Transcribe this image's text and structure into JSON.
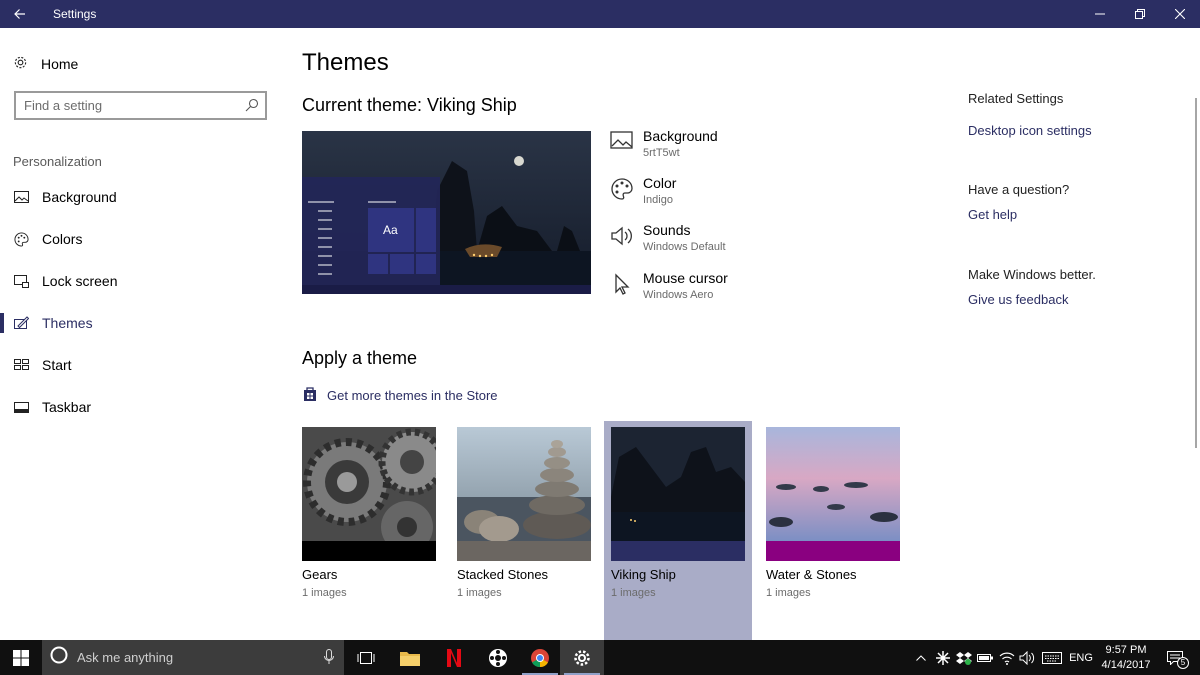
{
  "window": {
    "title": "Settings"
  },
  "sidebar": {
    "home_label": "Home",
    "search_placeholder": "Find a setting",
    "section_label": "Personalization",
    "items": [
      {
        "label": "Background",
        "icon": "picture-icon"
      },
      {
        "label": "Colors",
        "icon": "palette-icon"
      },
      {
        "label": "Lock screen",
        "icon": "lock-screen-icon"
      },
      {
        "label": "Themes",
        "icon": "brush-icon",
        "active": true
      },
      {
        "label": "Start",
        "icon": "start-icon"
      },
      {
        "label": "Taskbar",
        "icon": "taskbar-icon"
      }
    ]
  },
  "main": {
    "title": "Themes",
    "current_theme": "Current theme: Viking Ship",
    "preview_sample_text": "Aa",
    "properties": [
      {
        "label": "Background",
        "value": "5rtT5wt",
        "icon": "picture-icon"
      },
      {
        "label": "Color",
        "value": "Indigo",
        "icon": "palette-icon"
      },
      {
        "label": "Sounds",
        "value": "Windows Default",
        "icon": "speaker-icon"
      },
      {
        "label": "Mouse cursor",
        "value": "Windows Aero",
        "icon": "cursor-icon"
      }
    ],
    "apply_title": "Apply a theme",
    "store_link": "Get more themes in the Store",
    "themes": [
      {
        "name": "Gears",
        "count": "1 images",
        "accent": "#000000"
      },
      {
        "name": "Stacked Stones",
        "count": "1 images",
        "accent": "#6b6661"
      },
      {
        "name": "Viking Ship",
        "count": "1 images",
        "accent": "#2b2e63",
        "selected": true
      },
      {
        "name": "Water & Stones",
        "count": "1 images",
        "accent": "#8a0080"
      }
    ]
  },
  "related": {
    "heading": "Related Settings",
    "desktop_icon_link": "Desktop icon settings",
    "question_heading": "Have a question?",
    "help_link": "Get help",
    "better_heading": "Make Windows better.",
    "feedback_link": "Give us feedback"
  },
  "taskbar": {
    "search_placeholder": "Ask me anything",
    "language": "ENG",
    "time": "9:57 PM",
    "date": "4/14/2017",
    "notification_count": "5"
  },
  "colors": {
    "accent": "#2b2e63",
    "taskbar": "#101010"
  }
}
